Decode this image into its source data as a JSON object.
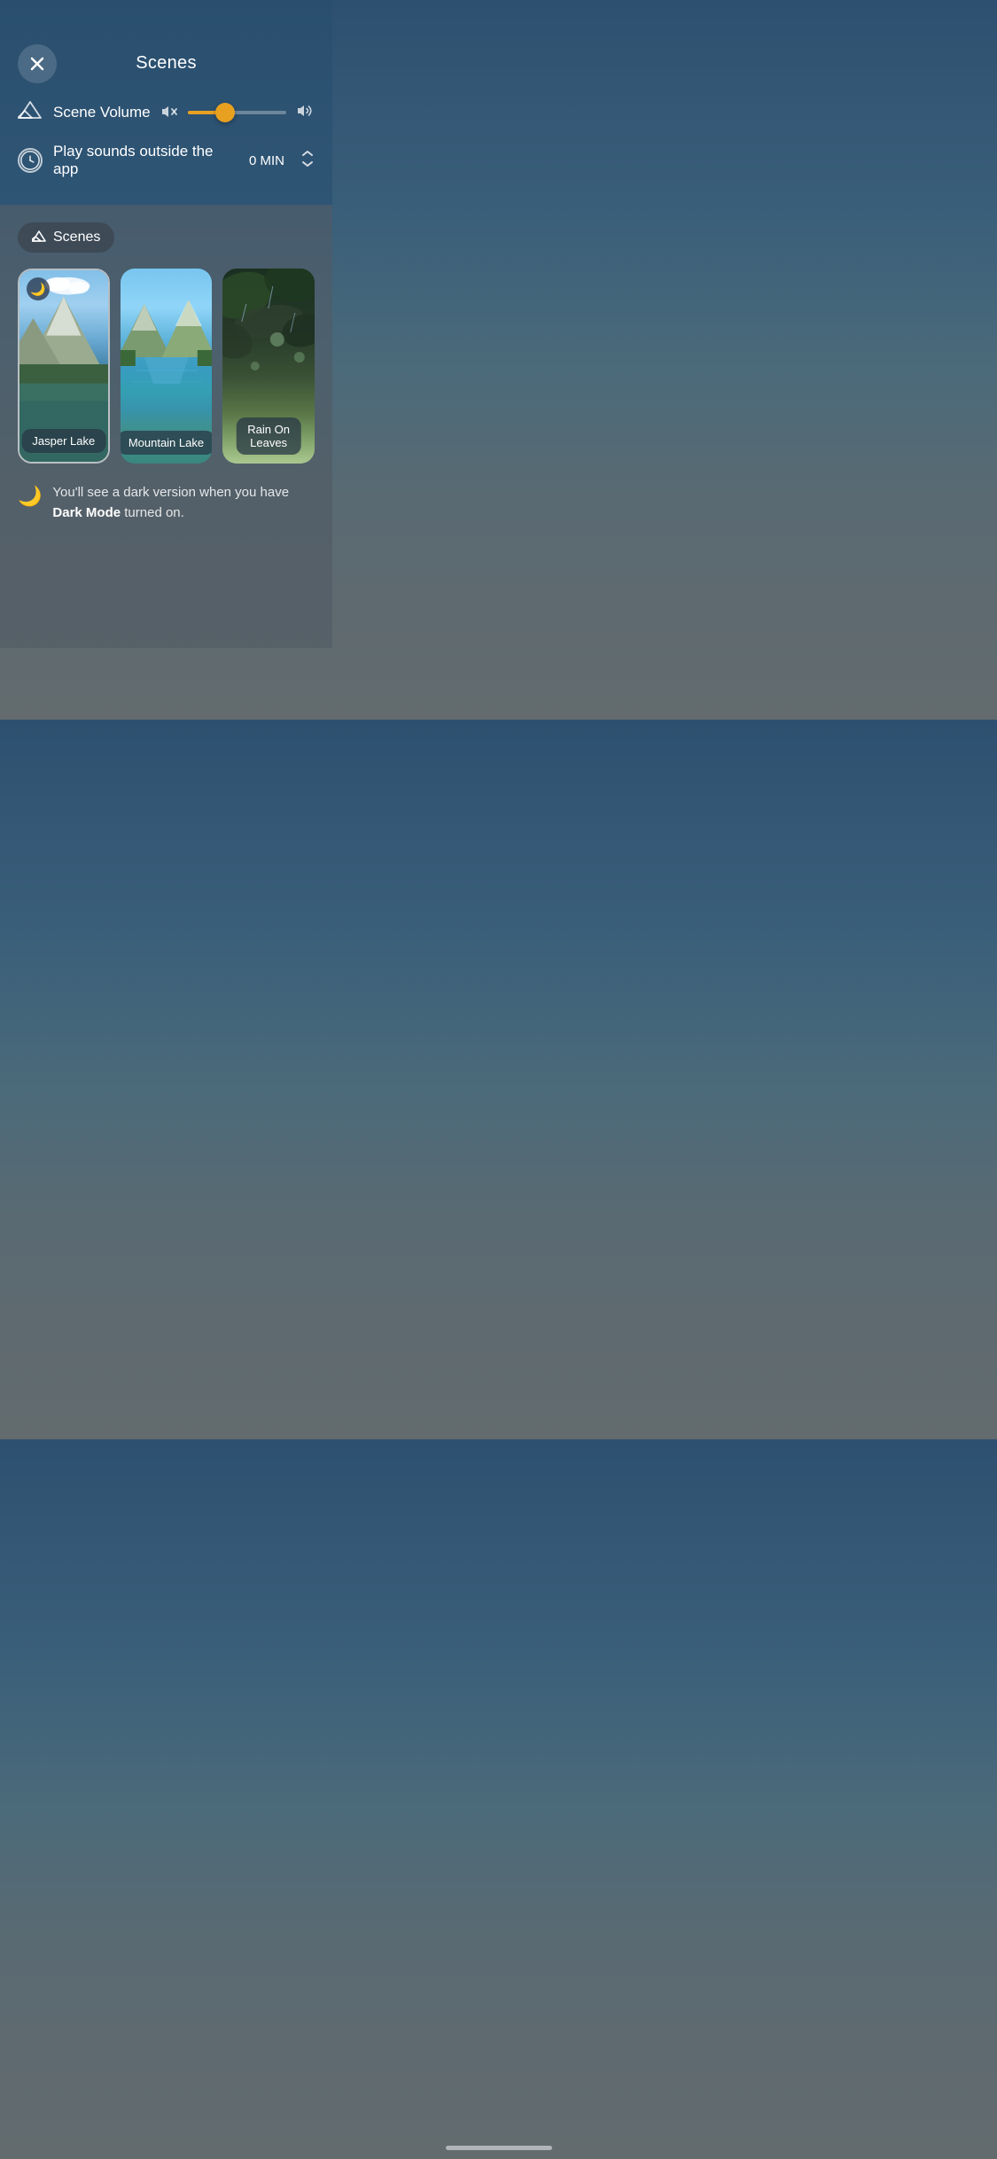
{
  "header": {
    "title": "Scenes",
    "close_label": "×"
  },
  "volume_control": {
    "label": "Scene Volume",
    "mountain_icon": "▲",
    "mute_icon": "🔇",
    "volume_up_icon": "🔊",
    "slider_percent": 38
  },
  "timer_control": {
    "label": "Play sounds outside the app",
    "value": "0 MIN",
    "clock_icon": "🕐",
    "chevron_icon": "⌃"
  },
  "scenes_tab": {
    "label": "Scenes",
    "icon": "▲"
  },
  "scenes": [
    {
      "name": "Jasper Lake",
      "has_dark_mode": true,
      "dark_mode_icon": "🌙"
    },
    {
      "name": "Mountain Lake",
      "has_dark_mode": false
    },
    {
      "name": "Rain On Leaves",
      "has_dark_mode": false
    }
  ],
  "dark_mode_note": {
    "icon": "🌙",
    "text_regular": "You'll see a dark version when you have ",
    "text_bold": "Dark Mode",
    "text_end": " turned on."
  }
}
